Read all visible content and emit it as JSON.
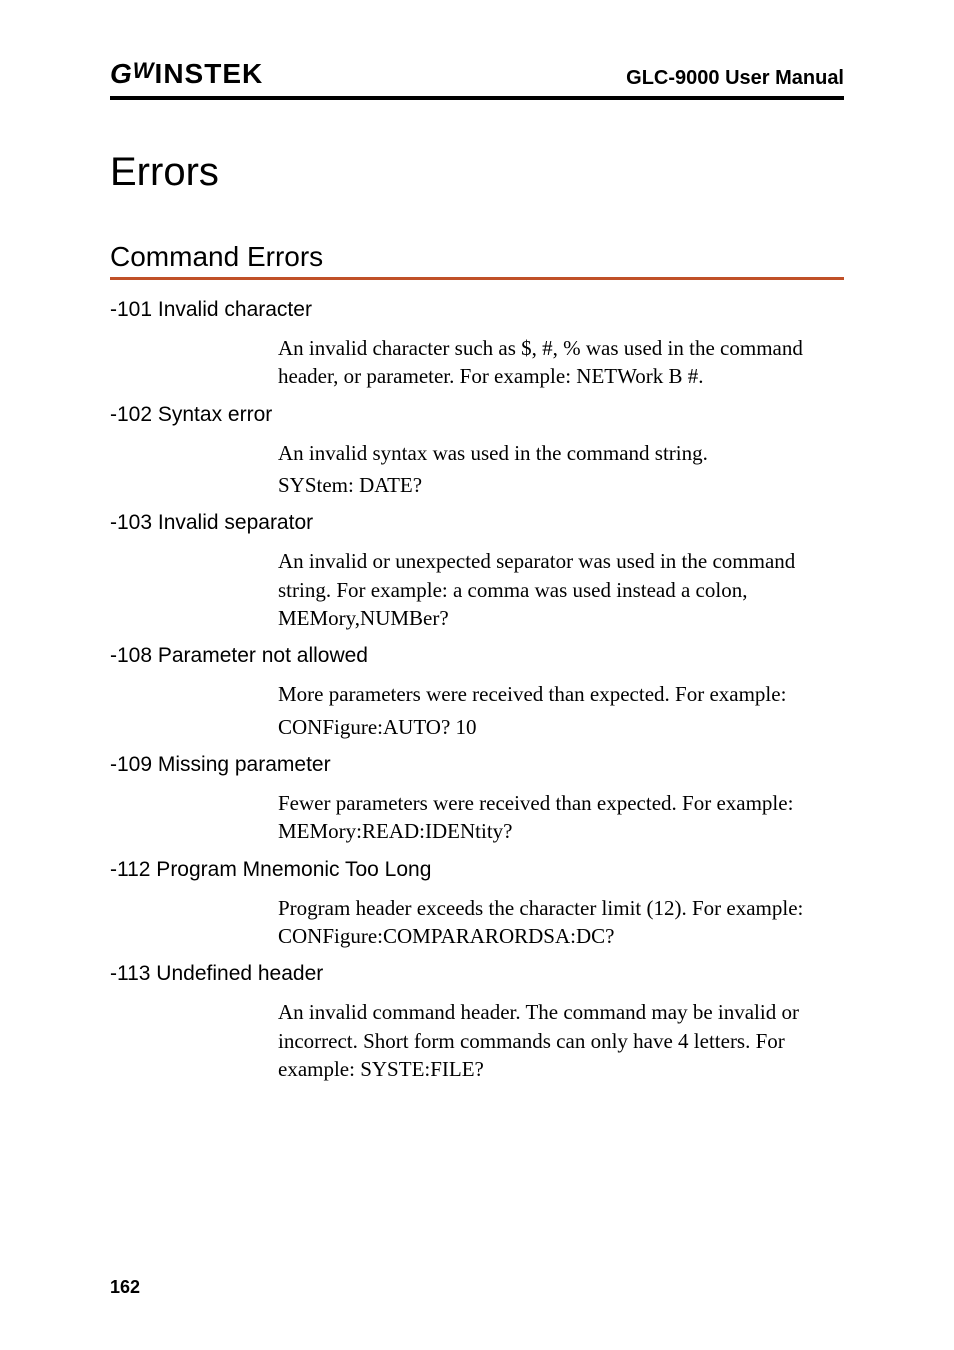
{
  "header": {
    "logo_gw": "G",
    "logo_instek": "INSTEK",
    "manual_title": "GLC-9000 User Manual"
  },
  "title": "Errors",
  "section_title": "Command Errors",
  "errors": [
    {
      "heading": "-101 Invalid character",
      "body": [
        "An invalid character such as $, #, % was used in the command header, or parameter. For example: NETWork B #."
      ]
    },
    {
      "heading": "-102 Syntax error",
      "body": [
        "An invalid syntax was used in the command string.",
        "SYStem: DATE?"
      ]
    },
    {
      "heading": "-103 Invalid separator",
      "body": [
        "An invalid or unexpected separator was used in the command string. For example: a comma was used instead a colon, MEMory,NUMBer?"
      ]
    },
    {
      "heading": "-108 Parameter not allowed",
      "body": [
        "More parameters were received than expected. For example:",
        "CONFigure:AUTO? 10"
      ]
    },
    {
      "heading": "-109 Missing parameter",
      "body": [
        "Fewer parameters were received than expected. For example: MEMory:READ:IDENtity?"
      ]
    },
    {
      "heading": "-112 Program Mnemonic Too Long",
      "body": [
        "Program header exceeds the character limit (12). For example: CONFigure:COMPARARORDSA:DC?"
      ]
    },
    {
      "heading": "-113 Undefined header",
      "body": [
        "An invalid command header. The command may be invalid or incorrect. Short form commands can only have 4 letters. For example: SYSTE:FILE?"
      ]
    }
  ],
  "page_number": "162"
}
